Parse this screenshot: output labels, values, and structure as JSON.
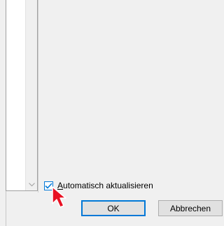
{
  "dialog": {
    "listbox": {
      "scroll_down_icon": "chevron-down-icon"
    },
    "auto_update": {
      "checked": true,
      "label_first_letter": "A",
      "label_rest": "utomatisch aktualisieren"
    },
    "buttons": {
      "ok_label": "OK",
      "cancel_label": "Abbrechen"
    },
    "colors": {
      "accent": "#0078d7",
      "cursor": "#e81123"
    }
  }
}
